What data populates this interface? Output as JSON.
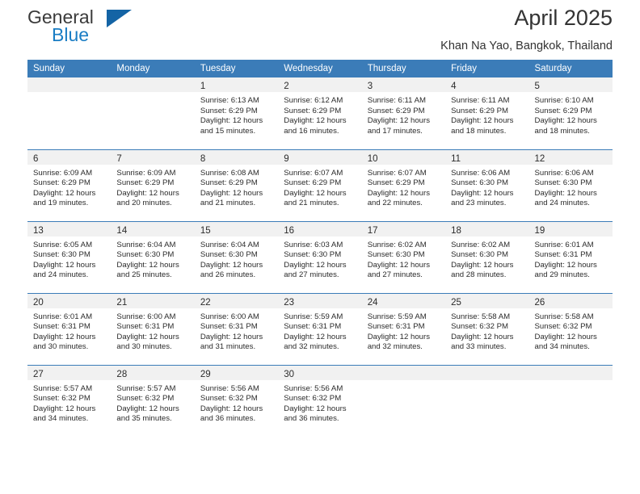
{
  "brand": {
    "name_part1": "General",
    "name_part2": "Blue",
    "triangle_icon": "brand-triangle-icon",
    "colors": {
      "dark": "#3a3a3a",
      "blue": "#1a7dc4",
      "triangle": "#1464a5"
    }
  },
  "header": {
    "title": "April 2025",
    "subtitle": "Khan Na Yao, Bangkok, Thailand"
  },
  "theme": {
    "header_blue": "#3b7cb8",
    "daynum_strip": "#f1f1f1",
    "text": "#2b2b2b"
  },
  "weekday_headers": [
    "Sunday",
    "Monday",
    "Tuesday",
    "Wednesday",
    "Thursday",
    "Friday",
    "Saturday"
  ],
  "weeks": [
    [
      {
        "day": "",
        "sunrise": "",
        "sunset": "",
        "daylight1": "",
        "daylight2": "",
        "empty": true
      },
      {
        "day": "",
        "sunrise": "",
        "sunset": "",
        "daylight1": "",
        "daylight2": "",
        "empty": true
      },
      {
        "day": "1",
        "sunrise": "Sunrise: 6:13 AM",
        "sunset": "Sunset: 6:29 PM",
        "daylight1": "Daylight: 12 hours",
        "daylight2": "and 15 minutes."
      },
      {
        "day": "2",
        "sunrise": "Sunrise: 6:12 AM",
        "sunset": "Sunset: 6:29 PM",
        "daylight1": "Daylight: 12 hours",
        "daylight2": "and 16 minutes."
      },
      {
        "day": "3",
        "sunrise": "Sunrise: 6:11 AM",
        "sunset": "Sunset: 6:29 PM",
        "daylight1": "Daylight: 12 hours",
        "daylight2": "and 17 minutes."
      },
      {
        "day": "4",
        "sunrise": "Sunrise: 6:11 AM",
        "sunset": "Sunset: 6:29 PM",
        "daylight1": "Daylight: 12 hours",
        "daylight2": "and 18 minutes."
      },
      {
        "day": "5",
        "sunrise": "Sunrise: 6:10 AM",
        "sunset": "Sunset: 6:29 PM",
        "daylight1": "Daylight: 12 hours",
        "daylight2": "and 18 minutes."
      }
    ],
    [
      {
        "day": "6",
        "sunrise": "Sunrise: 6:09 AM",
        "sunset": "Sunset: 6:29 PM",
        "daylight1": "Daylight: 12 hours",
        "daylight2": "and 19 minutes."
      },
      {
        "day": "7",
        "sunrise": "Sunrise: 6:09 AM",
        "sunset": "Sunset: 6:29 PM",
        "daylight1": "Daylight: 12 hours",
        "daylight2": "and 20 minutes."
      },
      {
        "day": "8",
        "sunrise": "Sunrise: 6:08 AM",
        "sunset": "Sunset: 6:29 PM",
        "daylight1": "Daylight: 12 hours",
        "daylight2": "and 21 minutes."
      },
      {
        "day": "9",
        "sunrise": "Sunrise: 6:07 AM",
        "sunset": "Sunset: 6:29 PM",
        "daylight1": "Daylight: 12 hours",
        "daylight2": "and 21 minutes."
      },
      {
        "day": "10",
        "sunrise": "Sunrise: 6:07 AM",
        "sunset": "Sunset: 6:29 PM",
        "daylight1": "Daylight: 12 hours",
        "daylight2": "and 22 minutes."
      },
      {
        "day": "11",
        "sunrise": "Sunrise: 6:06 AM",
        "sunset": "Sunset: 6:30 PM",
        "daylight1": "Daylight: 12 hours",
        "daylight2": "and 23 minutes."
      },
      {
        "day": "12",
        "sunrise": "Sunrise: 6:06 AM",
        "sunset": "Sunset: 6:30 PM",
        "daylight1": "Daylight: 12 hours",
        "daylight2": "and 24 minutes."
      }
    ],
    [
      {
        "day": "13",
        "sunrise": "Sunrise: 6:05 AM",
        "sunset": "Sunset: 6:30 PM",
        "daylight1": "Daylight: 12 hours",
        "daylight2": "and 24 minutes."
      },
      {
        "day": "14",
        "sunrise": "Sunrise: 6:04 AM",
        "sunset": "Sunset: 6:30 PM",
        "daylight1": "Daylight: 12 hours",
        "daylight2": "and 25 minutes."
      },
      {
        "day": "15",
        "sunrise": "Sunrise: 6:04 AM",
        "sunset": "Sunset: 6:30 PM",
        "daylight1": "Daylight: 12 hours",
        "daylight2": "and 26 minutes."
      },
      {
        "day": "16",
        "sunrise": "Sunrise: 6:03 AM",
        "sunset": "Sunset: 6:30 PM",
        "daylight1": "Daylight: 12 hours",
        "daylight2": "and 27 minutes."
      },
      {
        "day": "17",
        "sunrise": "Sunrise: 6:02 AM",
        "sunset": "Sunset: 6:30 PM",
        "daylight1": "Daylight: 12 hours",
        "daylight2": "and 27 minutes."
      },
      {
        "day": "18",
        "sunrise": "Sunrise: 6:02 AM",
        "sunset": "Sunset: 6:30 PM",
        "daylight1": "Daylight: 12 hours",
        "daylight2": "and 28 minutes."
      },
      {
        "day": "19",
        "sunrise": "Sunrise: 6:01 AM",
        "sunset": "Sunset: 6:31 PM",
        "daylight1": "Daylight: 12 hours",
        "daylight2": "and 29 minutes."
      }
    ],
    [
      {
        "day": "20",
        "sunrise": "Sunrise: 6:01 AM",
        "sunset": "Sunset: 6:31 PM",
        "daylight1": "Daylight: 12 hours",
        "daylight2": "and 30 minutes."
      },
      {
        "day": "21",
        "sunrise": "Sunrise: 6:00 AM",
        "sunset": "Sunset: 6:31 PM",
        "daylight1": "Daylight: 12 hours",
        "daylight2": "and 30 minutes."
      },
      {
        "day": "22",
        "sunrise": "Sunrise: 6:00 AM",
        "sunset": "Sunset: 6:31 PM",
        "daylight1": "Daylight: 12 hours",
        "daylight2": "and 31 minutes."
      },
      {
        "day": "23",
        "sunrise": "Sunrise: 5:59 AM",
        "sunset": "Sunset: 6:31 PM",
        "daylight1": "Daylight: 12 hours",
        "daylight2": "and 32 minutes."
      },
      {
        "day": "24",
        "sunrise": "Sunrise: 5:59 AM",
        "sunset": "Sunset: 6:31 PM",
        "daylight1": "Daylight: 12 hours",
        "daylight2": "and 32 minutes."
      },
      {
        "day": "25",
        "sunrise": "Sunrise: 5:58 AM",
        "sunset": "Sunset: 6:32 PM",
        "daylight1": "Daylight: 12 hours",
        "daylight2": "and 33 minutes."
      },
      {
        "day": "26",
        "sunrise": "Sunrise: 5:58 AM",
        "sunset": "Sunset: 6:32 PM",
        "daylight1": "Daylight: 12 hours",
        "daylight2": "and 34 minutes."
      }
    ],
    [
      {
        "day": "27",
        "sunrise": "Sunrise: 5:57 AM",
        "sunset": "Sunset: 6:32 PM",
        "daylight1": "Daylight: 12 hours",
        "daylight2": "and 34 minutes."
      },
      {
        "day": "28",
        "sunrise": "Sunrise: 5:57 AM",
        "sunset": "Sunset: 6:32 PM",
        "daylight1": "Daylight: 12 hours",
        "daylight2": "and 35 minutes."
      },
      {
        "day": "29",
        "sunrise": "Sunrise: 5:56 AM",
        "sunset": "Sunset: 6:32 PM",
        "daylight1": "Daylight: 12 hours",
        "daylight2": "and 36 minutes."
      },
      {
        "day": "30",
        "sunrise": "Sunrise: 5:56 AM",
        "sunset": "Sunset: 6:32 PM",
        "daylight1": "Daylight: 12 hours",
        "daylight2": "and 36 minutes."
      },
      {
        "day": "",
        "sunrise": "",
        "sunset": "",
        "daylight1": "",
        "daylight2": "",
        "empty": true
      },
      {
        "day": "",
        "sunrise": "",
        "sunset": "",
        "daylight1": "",
        "daylight2": "",
        "empty": true
      },
      {
        "day": "",
        "sunrise": "",
        "sunset": "",
        "daylight1": "",
        "daylight2": "",
        "empty": true
      }
    ]
  ]
}
